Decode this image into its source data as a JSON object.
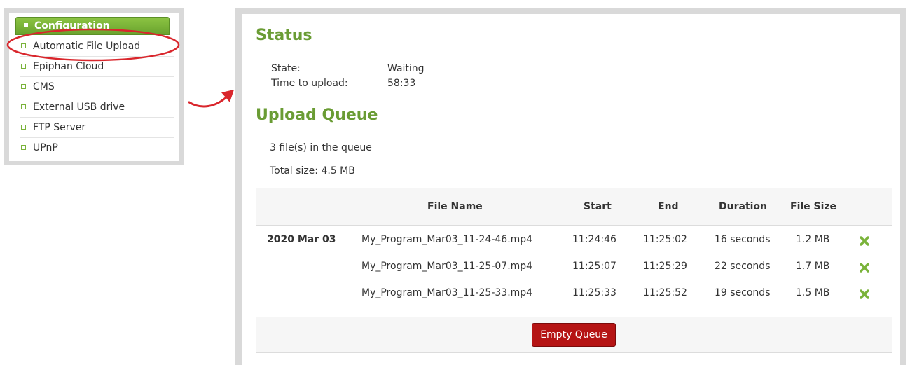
{
  "menu": {
    "header": "Configuration",
    "items": [
      {
        "label": "Automatic File Upload"
      },
      {
        "label": "Epiphan Cloud"
      },
      {
        "label": "CMS"
      },
      {
        "label": "External USB drive"
      },
      {
        "label": "FTP Server"
      },
      {
        "label": "UPnP"
      }
    ]
  },
  "status": {
    "title": "Status",
    "state_label": "State:",
    "state_value": "Waiting",
    "time_label": "Time to upload:",
    "time_value": "58:33"
  },
  "queue": {
    "title": "Upload Queue",
    "count_text": "3 file(s) in the queue",
    "total_text": "Total size: 4.5 MB",
    "columns": {
      "file_name": "File Name",
      "start": "Start",
      "end": "End",
      "duration": "Duration",
      "file_size": "File Size"
    },
    "rows": [
      {
        "date": "2020 Mar 03",
        "file": "My_Program_Mar03_11-24-46.mp4",
        "start": "11:24:46",
        "end": "11:25:02",
        "duration": "16 seconds",
        "size": "1.2 MB"
      },
      {
        "date": "",
        "file": "My_Program_Mar03_11-25-07.mp4",
        "start": "11:25:07",
        "end": "11:25:29",
        "duration": "22 seconds",
        "size": "1.7 MB"
      },
      {
        "date": "",
        "file": "My_Program_Mar03_11-25-33.mp4",
        "start": "11:25:33",
        "end": "11:25:52",
        "duration": "19 seconds",
        "size": "1.5 MB"
      }
    ],
    "empty_button": "Empty Queue",
    "delete_icon": "close-x-icon"
  },
  "colors": {
    "accent_green": "#6a9c34",
    "danger_red": "#b51414",
    "callout_red": "#d9262c"
  }
}
